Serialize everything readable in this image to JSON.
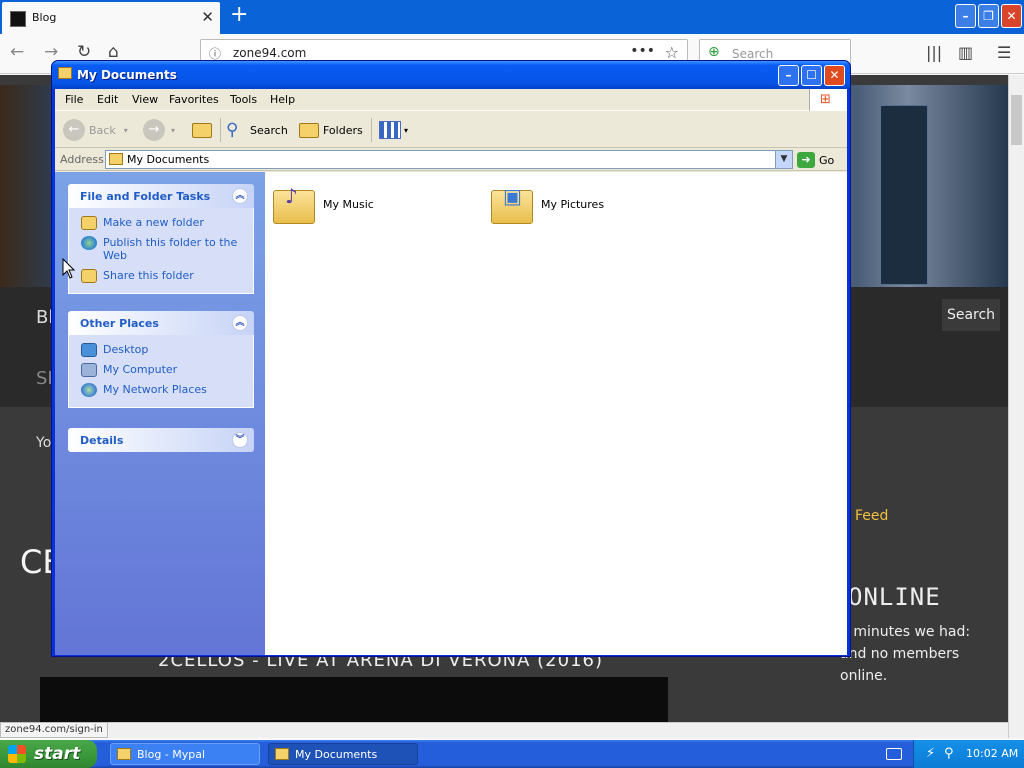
{
  "browser": {
    "tab_title": "Blog",
    "tab_close": "✕",
    "new_tab": "+",
    "url": "zone94.com",
    "page_actions": "•••",
    "bookmark_star": "☆",
    "search_placeholder": "Search",
    "status_url": "zone94.com/sign-in",
    "window_min": "–",
    "window_max": "❐",
    "window_close": "✕"
  },
  "webpage": {
    "search_button": "Search",
    "menu_fragment_1": "Bl",
    "menu_fragment_2": "SI",
    "text_fragment_yo": "Yo",
    "heading_fragment": "CE",
    "feed_label": "Feed",
    "online_heading": "ONLINE",
    "online_text": "5 minutes we had: and no members online.",
    "video_title": "2CELLOS - LIVE AT ARENA DI VERONA (2016)"
  },
  "explorer": {
    "title": "My Documents",
    "menu": [
      "File",
      "Edit",
      "View",
      "Favorites",
      "Tools",
      "Help"
    ],
    "toolbar": {
      "back": "Back",
      "search": "Search",
      "folders": "Folders"
    },
    "address_label": "Address",
    "address_value": "My Documents",
    "go_label": "Go",
    "tasks": {
      "title": "File and Folder Tasks",
      "links": [
        "Make a new folder",
        "Publish this folder to the Web",
        "Share this folder"
      ]
    },
    "other_places": {
      "title": "Other Places",
      "links": [
        "Desktop",
        "My Computer",
        "My Network Places"
      ]
    },
    "details": {
      "title": "Details"
    },
    "files": [
      {
        "name": "My Music",
        "icon": "music-folder-icon"
      },
      {
        "name": "My Pictures",
        "icon": "pictures-folder-icon"
      }
    ]
  },
  "taskbar": {
    "start_label": "start",
    "tasks": [
      "Blog - Mypal",
      "My Documents"
    ],
    "clock": "10:02 AM"
  }
}
